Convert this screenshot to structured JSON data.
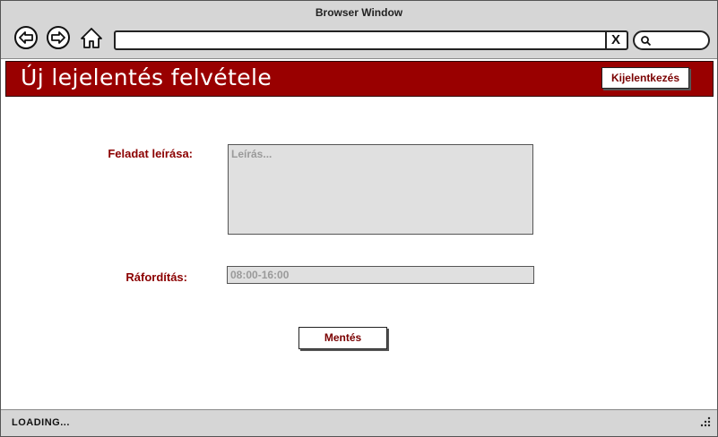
{
  "browser": {
    "window_title": "Browser Window",
    "address_clear": "X",
    "icons": [
      "back-arrow-icon",
      "forward-arrow-icon",
      "home-icon",
      "search-icon",
      "resize-grip-icon"
    ]
  },
  "header": {
    "title": "Új lejelentés felvétele",
    "logout_label": "Kijelentkezés",
    "background_color": "#990000"
  },
  "form": {
    "description_label": "Feladat leírása:",
    "description_placeholder": "Leírás...",
    "effort_label": "Ráfordítás:",
    "effort_placeholder": "08:00-16:00",
    "save_label": "Mentés"
  },
  "status": {
    "text": "LOADING..."
  }
}
